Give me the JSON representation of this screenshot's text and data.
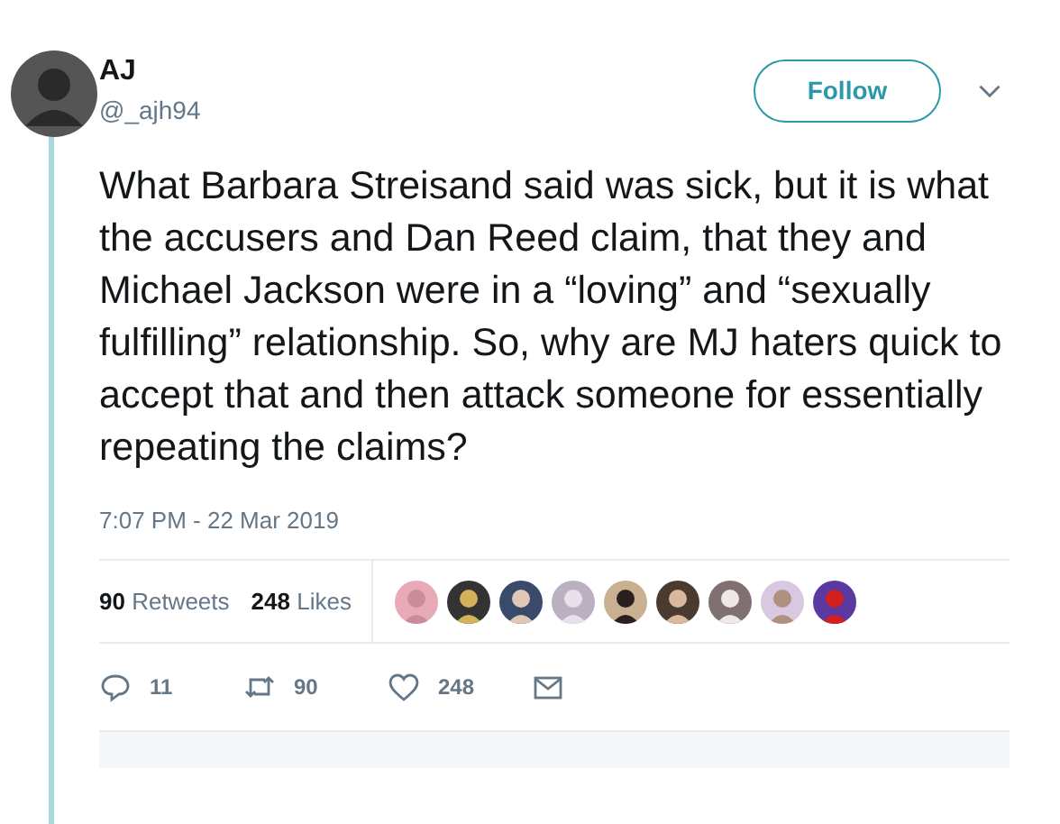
{
  "author": {
    "name": "AJ",
    "handle": "@_ajh94"
  },
  "follow_button": {
    "label": "Follow"
  },
  "tweet_text": "What Barbara Streisand said was sick, but it is what the accusers and Dan Reed claim, that they and Michael Jackson were in a “loving” and “sexually fulfilling” relationship. So, why are MJ haters quick to accept that and then attack someone for essentially repeating the claims?",
  "timestamp": "7:07 PM - 22 Mar 2019",
  "stats": [
    {
      "count": "90",
      "label": "Retweets"
    },
    {
      "count": "248",
      "label": "Likes"
    }
  ],
  "actions": [
    {
      "kind": "reply",
      "count": "11"
    },
    {
      "kind": "retweet",
      "count": "90"
    },
    {
      "kind": "like",
      "count": "248"
    },
    {
      "kind": "message"
    }
  ]
}
